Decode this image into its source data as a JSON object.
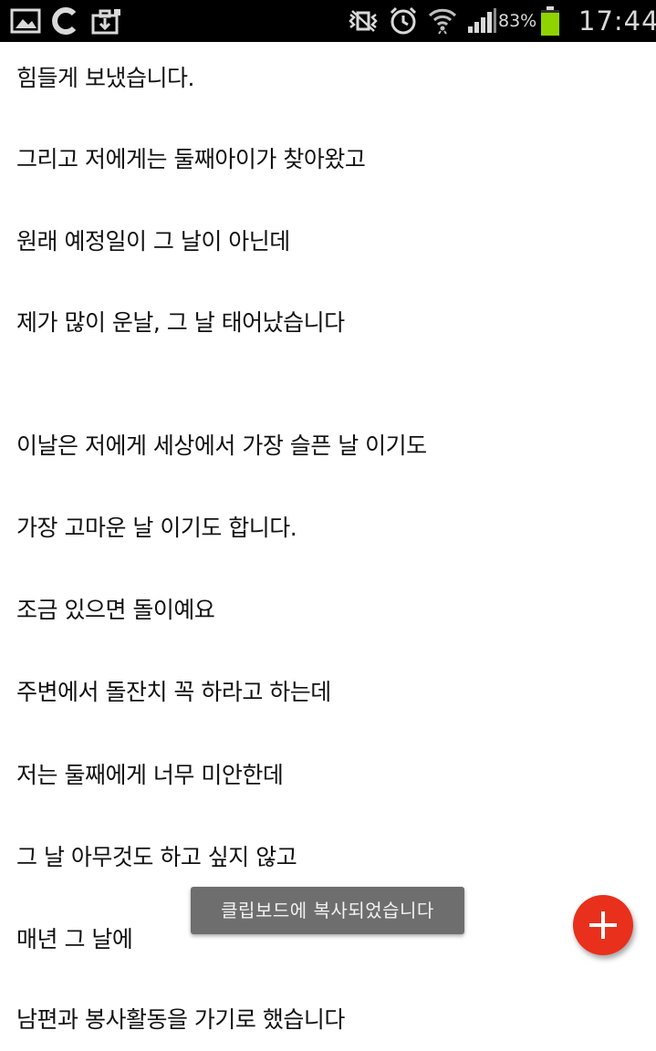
{
  "status_bar": {
    "left_icons": [
      "gallery-icon",
      "sync-c-icon",
      "briefcase-download-icon"
    ],
    "right_icons": [
      "vibrate-icon",
      "alarm-clock-icon",
      "wifi-icon",
      "signal-icon"
    ],
    "battery_percent": "83%",
    "battery_level": 0.83,
    "time": "17:44"
  },
  "content": {
    "lines": [
      "힘들게 보냈습니다.",
      "그리고 저에게는 둘째아이가 찾아왔고",
      "원래 예정일이 그 날이 아닌데",
      "제가 많이 운날, 그 날 태어났습니다",
      "이날은 저에게 세상에서 가장 슬픈 날 이기도",
      "가장 고마운 날 이기도 합니다.",
      "조금 있으면 돌이예요",
      "주변에서 돌잔치 꼭 하라고 하는데",
      "저는 둘째에게 너무 미안한데",
      "그 날 아무것도 하고 싶지 않고",
      "매년 그 날에",
      "남편과 봉사활동을 가기로 했습니다"
    ]
  },
  "toast": {
    "message": "클립보드에 복사되었습니다"
  },
  "fab": {
    "icon": "plus-icon",
    "color": "#e8301c"
  }
}
